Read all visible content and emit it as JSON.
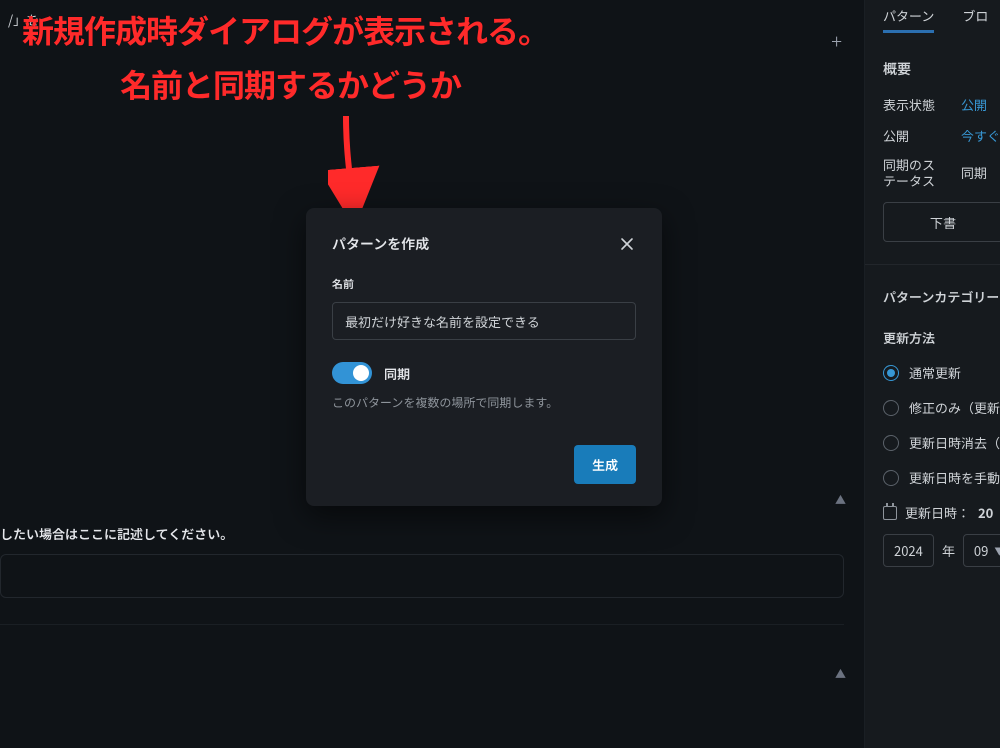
{
  "annotation": {
    "line1": "新規作成時ダイアログが表示される。",
    "line2": "名前と同期するかどうか"
  },
  "canvas": {
    "top_truncated": "/」を",
    "plus_label": "+",
    "bottom_hint": "したい場合はここに記述してください。"
  },
  "modal": {
    "title": "パターンを作成",
    "name_label": "名前",
    "name_value": "最初だけ好きな名前を設定できる",
    "sync_label": "同期",
    "sync_on": true,
    "help": "このパターンを複数の場所で同期します。",
    "submit": "生成"
  },
  "sidebar": {
    "tabs": {
      "pattern": "パターン",
      "pro": "ブロ"
    },
    "overview": {
      "head": "概要",
      "visibility_k": "表示状態",
      "visibility_v": "公開",
      "publish_k": "公開",
      "publish_v": "今すぐ",
      "sync_k1": "同期のス",
      "sync_k2": "テータス",
      "sync_v": "同期",
      "draft_btn": "下書"
    },
    "category_head": "パターンカテゴリー",
    "update": {
      "head": "更新方法",
      "opts": {
        "normal": "通常更新",
        "fix_only": "修正のみ（更新日",
        "erase_ts": "更新日時消去（ ",
        "manual_ts": "更新日時を手動"
      },
      "date_label": "更新日時：",
      "date_suffix": "20",
      "year_value": "2024",
      "year_unit": "年",
      "month_value": "09"
    }
  }
}
